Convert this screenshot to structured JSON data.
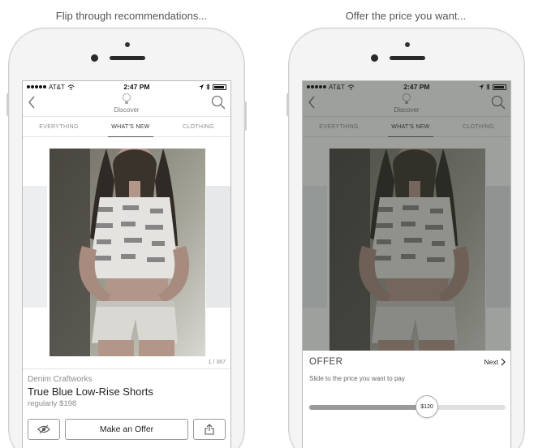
{
  "captions": {
    "left": "Flip through recommendations...",
    "right": "Offer the price you want..."
  },
  "status_bar": {
    "carrier": "AT&T",
    "time": "2:47 PM"
  },
  "nav": {
    "title": "Discover"
  },
  "tabs": [
    {
      "label": "EVERYTHING"
    },
    {
      "label": "WHAT'S NEW"
    },
    {
      "label": "CLOTHING"
    }
  ],
  "active_tab": "WHAT'S NEW",
  "product": {
    "counter": "1 / 367",
    "brand": "Denim Craftworks",
    "name": "True Blue Low-Rise Shorts",
    "price": "regularly $198"
  },
  "actions": {
    "offer_label": "Make an Offer"
  },
  "offer_panel": {
    "title": "OFFER",
    "next_label": "Next",
    "subtitle": "Slide to the price you want to pay",
    "slider_value_label": "$120",
    "slider_fraction": 0.6
  },
  "colors": {
    "overlay": "#525a4e",
    "active_tab_underline": "#555555",
    "slider_fill": "#9a9a9a"
  }
}
